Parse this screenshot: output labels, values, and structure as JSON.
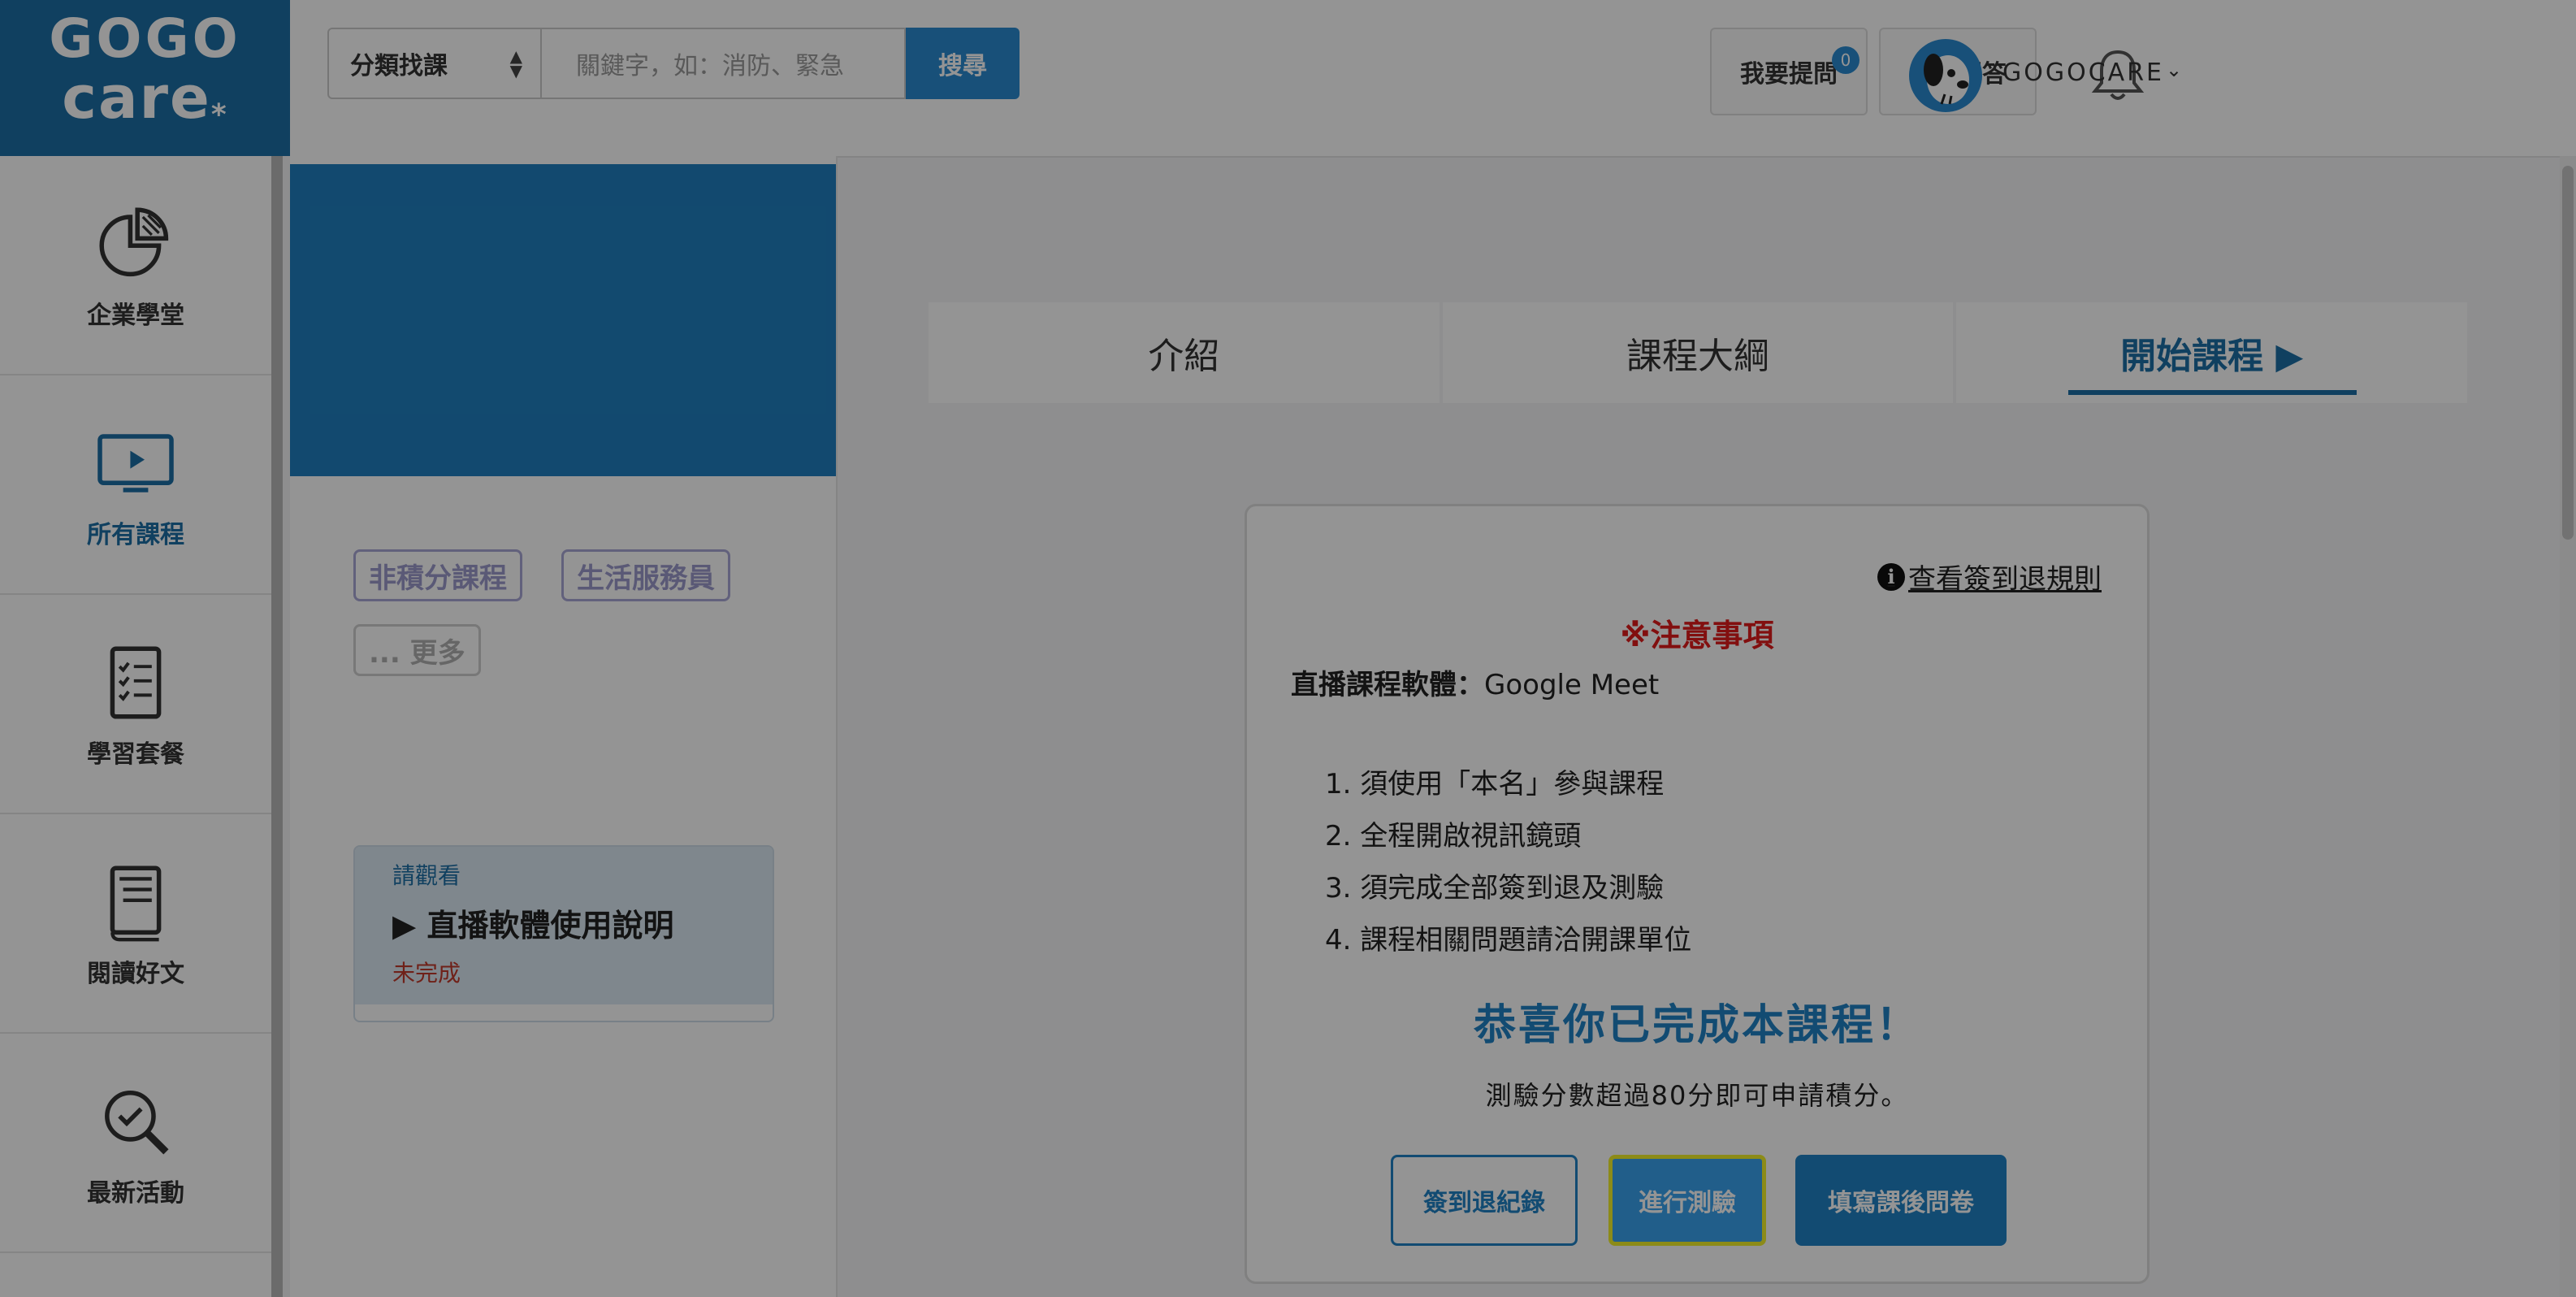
{
  "brand": {
    "logo_line1": "GOGO",
    "logo_line2": "care",
    "logo_mark": "*"
  },
  "search": {
    "category_label": "分類找課",
    "placeholder": "關鍵字，如：消防、緊急",
    "button_label": "搜尋"
  },
  "header": {
    "ask_label": "我要提問",
    "faq_label": "常見問答",
    "notification_count": "0",
    "user_name": "GOGOCARE"
  },
  "sidebar": {
    "items": [
      {
        "label": "企業學堂",
        "icon": "pie-chart-icon",
        "active": false
      },
      {
        "label": "所有課程",
        "icon": "monitor-play-icon",
        "active": true
      },
      {
        "label": "學習套餐",
        "icon": "checklist-icon",
        "active": false
      },
      {
        "label": "閱讀好文",
        "icon": "book-icon",
        "active": false
      },
      {
        "label": "最新活動",
        "icon": "search-check-icon",
        "active": false
      }
    ]
  },
  "course": {
    "tags": [
      "非積分課程",
      "生活服務員"
    ],
    "more_label": "... 更多",
    "watch": {
      "hint": "請觀看",
      "title": "直播軟體使用說明",
      "status": "未完成"
    }
  },
  "tabs": [
    {
      "label": "介紹",
      "active": false
    },
    {
      "label": "課程大綱",
      "active": false
    },
    {
      "label": "開始課程 ▶",
      "active": true
    }
  ],
  "notice": {
    "rule_link": "查看簽到退規則",
    "title": "※注意事項",
    "software_label": "直播課程軟體：",
    "software_value": "Google Meet",
    "rules": [
      "1. 須使用「本名」參與課程",
      "2. 全程開啟視訊鏡頭",
      "3. 須完成全部簽到退及測驗",
      "4. 課程相關問題請洽開課單位"
    ],
    "congrats": "恭喜你已完成本課程！",
    "score_note": "測驗分數超過80分即可申請積分。",
    "buttons": {
      "checkin_record": "簽到退紀錄",
      "take_quiz": "進行測驗",
      "survey": "填寫課後問卷"
    }
  },
  "colors": {
    "brand_blue": "#1d6fa5",
    "accent_blue": "#1f82c4",
    "warning_red": "#e01b1b",
    "focus_yellow": "#f1ef2a"
  }
}
